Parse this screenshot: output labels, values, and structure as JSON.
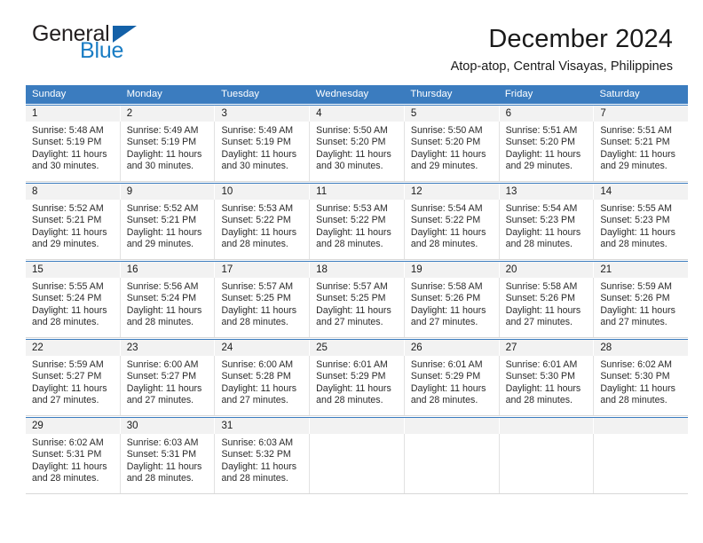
{
  "brand": {
    "name_top": "General",
    "name_bottom": "Blue",
    "triangle_color": "#1461a8",
    "blue_color": "#1a7dc4"
  },
  "header": {
    "title": "December 2024",
    "subtitle": "Atop-atop, Central Visayas, Philippines"
  },
  "theme": {
    "header_band": "#3b7cbf",
    "daynum_bg": "#f2f2f2",
    "text": "#1a1a1a"
  },
  "weekdays": [
    "Sunday",
    "Monday",
    "Tuesday",
    "Wednesday",
    "Thursday",
    "Friday",
    "Saturday"
  ],
  "weeks": [
    {
      "daynums": [
        "1",
        "2",
        "3",
        "4",
        "5",
        "6",
        "7"
      ],
      "days": [
        {
          "sunrise": "Sunrise: 5:48 AM",
          "sunset": "Sunset: 5:19 PM",
          "daylight1": "Daylight: 11 hours",
          "daylight2": "and 30 minutes."
        },
        {
          "sunrise": "Sunrise: 5:49 AM",
          "sunset": "Sunset: 5:19 PM",
          "daylight1": "Daylight: 11 hours",
          "daylight2": "and 30 minutes."
        },
        {
          "sunrise": "Sunrise: 5:49 AM",
          "sunset": "Sunset: 5:19 PM",
          "daylight1": "Daylight: 11 hours",
          "daylight2": "and 30 minutes."
        },
        {
          "sunrise": "Sunrise: 5:50 AM",
          "sunset": "Sunset: 5:20 PM",
          "daylight1": "Daylight: 11 hours",
          "daylight2": "and 30 minutes."
        },
        {
          "sunrise": "Sunrise: 5:50 AM",
          "sunset": "Sunset: 5:20 PM",
          "daylight1": "Daylight: 11 hours",
          "daylight2": "and 29 minutes."
        },
        {
          "sunrise": "Sunrise: 5:51 AM",
          "sunset": "Sunset: 5:20 PM",
          "daylight1": "Daylight: 11 hours",
          "daylight2": "and 29 minutes."
        },
        {
          "sunrise": "Sunrise: 5:51 AM",
          "sunset": "Sunset: 5:21 PM",
          "daylight1": "Daylight: 11 hours",
          "daylight2": "and 29 minutes."
        }
      ]
    },
    {
      "daynums": [
        "8",
        "9",
        "10",
        "11",
        "12",
        "13",
        "14"
      ],
      "days": [
        {
          "sunrise": "Sunrise: 5:52 AM",
          "sunset": "Sunset: 5:21 PM",
          "daylight1": "Daylight: 11 hours",
          "daylight2": "and 29 minutes."
        },
        {
          "sunrise": "Sunrise: 5:52 AM",
          "sunset": "Sunset: 5:21 PM",
          "daylight1": "Daylight: 11 hours",
          "daylight2": "and 29 minutes."
        },
        {
          "sunrise": "Sunrise: 5:53 AM",
          "sunset": "Sunset: 5:22 PM",
          "daylight1": "Daylight: 11 hours",
          "daylight2": "and 28 minutes."
        },
        {
          "sunrise": "Sunrise: 5:53 AM",
          "sunset": "Sunset: 5:22 PM",
          "daylight1": "Daylight: 11 hours",
          "daylight2": "and 28 minutes."
        },
        {
          "sunrise": "Sunrise: 5:54 AM",
          "sunset": "Sunset: 5:22 PM",
          "daylight1": "Daylight: 11 hours",
          "daylight2": "and 28 minutes."
        },
        {
          "sunrise": "Sunrise: 5:54 AM",
          "sunset": "Sunset: 5:23 PM",
          "daylight1": "Daylight: 11 hours",
          "daylight2": "and 28 minutes."
        },
        {
          "sunrise": "Sunrise: 5:55 AM",
          "sunset": "Sunset: 5:23 PM",
          "daylight1": "Daylight: 11 hours",
          "daylight2": "and 28 minutes."
        }
      ]
    },
    {
      "daynums": [
        "15",
        "16",
        "17",
        "18",
        "19",
        "20",
        "21"
      ],
      "days": [
        {
          "sunrise": "Sunrise: 5:55 AM",
          "sunset": "Sunset: 5:24 PM",
          "daylight1": "Daylight: 11 hours",
          "daylight2": "and 28 minutes."
        },
        {
          "sunrise": "Sunrise: 5:56 AM",
          "sunset": "Sunset: 5:24 PM",
          "daylight1": "Daylight: 11 hours",
          "daylight2": "and 28 minutes."
        },
        {
          "sunrise": "Sunrise: 5:57 AM",
          "sunset": "Sunset: 5:25 PM",
          "daylight1": "Daylight: 11 hours",
          "daylight2": "and 28 minutes."
        },
        {
          "sunrise": "Sunrise: 5:57 AM",
          "sunset": "Sunset: 5:25 PM",
          "daylight1": "Daylight: 11 hours",
          "daylight2": "and 27 minutes."
        },
        {
          "sunrise": "Sunrise: 5:58 AM",
          "sunset": "Sunset: 5:26 PM",
          "daylight1": "Daylight: 11 hours",
          "daylight2": "and 27 minutes."
        },
        {
          "sunrise": "Sunrise: 5:58 AM",
          "sunset": "Sunset: 5:26 PM",
          "daylight1": "Daylight: 11 hours",
          "daylight2": "and 27 minutes."
        },
        {
          "sunrise": "Sunrise: 5:59 AM",
          "sunset": "Sunset: 5:26 PM",
          "daylight1": "Daylight: 11 hours",
          "daylight2": "and 27 minutes."
        }
      ]
    },
    {
      "daynums": [
        "22",
        "23",
        "24",
        "25",
        "26",
        "27",
        "28"
      ],
      "days": [
        {
          "sunrise": "Sunrise: 5:59 AM",
          "sunset": "Sunset: 5:27 PM",
          "daylight1": "Daylight: 11 hours",
          "daylight2": "and 27 minutes."
        },
        {
          "sunrise": "Sunrise: 6:00 AM",
          "sunset": "Sunset: 5:27 PM",
          "daylight1": "Daylight: 11 hours",
          "daylight2": "and 27 minutes."
        },
        {
          "sunrise": "Sunrise: 6:00 AM",
          "sunset": "Sunset: 5:28 PM",
          "daylight1": "Daylight: 11 hours",
          "daylight2": "and 27 minutes."
        },
        {
          "sunrise": "Sunrise: 6:01 AM",
          "sunset": "Sunset: 5:29 PM",
          "daylight1": "Daylight: 11 hours",
          "daylight2": "and 28 minutes."
        },
        {
          "sunrise": "Sunrise: 6:01 AM",
          "sunset": "Sunset: 5:29 PM",
          "daylight1": "Daylight: 11 hours",
          "daylight2": "and 28 minutes."
        },
        {
          "sunrise": "Sunrise: 6:01 AM",
          "sunset": "Sunset: 5:30 PM",
          "daylight1": "Daylight: 11 hours",
          "daylight2": "and 28 minutes."
        },
        {
          "sunrise": "Sunrise: 6:02 AM",
          "sunset": "Sunset: 5:30 PM",
          "daylight1": "Daylight: 11 hours",
          "daylight2": "and 28 minutes."
        }
      ]
    },
    {
      "daynums": [
        "29",
        "30",
        "31",
        "",
        "",
        "",
        ""
      ],
      "days": [
        {
          "sunrise": "Sunrise: 6:02 AM",
          "sunset": "Sunset: 5:31 PM",
          "daylight1": "Daylight: 11 hours",
          "daylight2": "and 28 minutes."
        },
        {
          "sunrise": "Sunrise: 6:03 AM",
          "sunset": "Sunset: 5:31 PM",
          "daylight1": "Daylight: 11 hours",
          "daylight2": "and 28 minutes."
        },
        {
          "sunrise": "Sunrise: 6:03 AM",
          "sunset": "Sunset: 5:32 PM",
          "daylight1": "Daylight: 11 hours",
          "daylight2": "and 28 minutes."
        },
        {
          "sunrise": "",
          "sunset": "",
          "daylight1": "",
          "daylight2": ""
        },
        {
          "sunrise": "",
          "sunset": "",
          "daylight1": "",
          "daylight2": ""
        },
        {
          "sunrise": "",
          "sunset": "",
          "daylight1": "",
          "daylight2": ""
        },
        {
          "sunrise": "",
          "sunset": "",
          "daylight1": "",
          "daylight2": ""
        }
      ]
    }
  ]
}
